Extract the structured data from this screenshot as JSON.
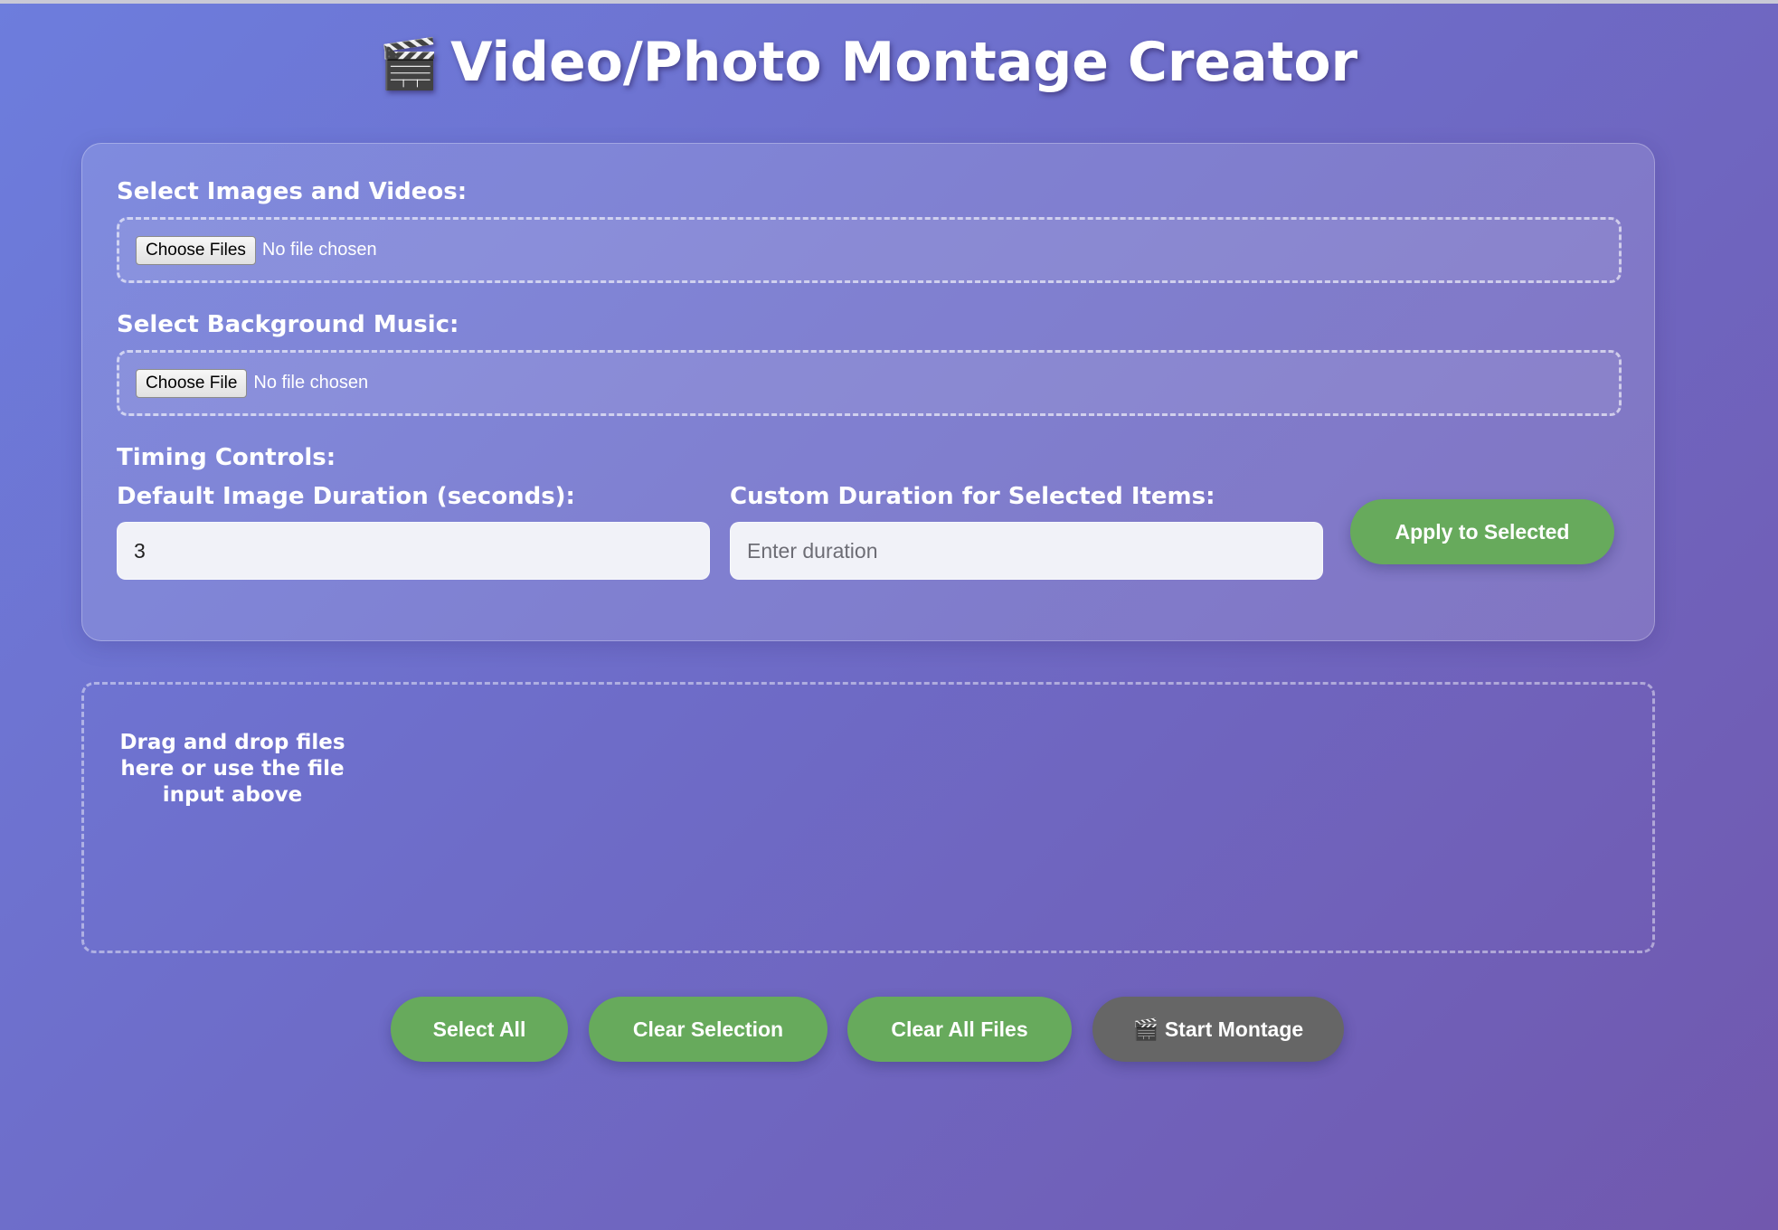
{
  "title": {
    "icon": "🎬",
    "text": "Video/Photo Montage Creator"
  },
  "media_input": {
    "label": "Select Images and Videos:",
    "button_label": "Choose Files",
    "status": "No file chosen"
  },
  "music_input": {
    "label": "Select Background Music:",
    "button_label": "Choose File",
    "status": "No file chosen"
  },
  "timing": {
    "heading": "Timing Controls:",
    "default_label": "Default Image Duration (seconds):",
    "default_value": "3",
    "custom_label": "Custom Duration for Selected Items:",
    "custom_placeholder": "Enter duration",
    "apply_label": "Apply to Selected"
  },
  "drop_zone": {
    "text": "Drag and drop files here or use the file input above"
  },
  "actions": {
    "select_all": "Select All",
    "clear_selection": "Clear Selection",
    "clear_all": "Clear All Files",
    "start_icon": "🎬",
    "start": "Start Montage"
  },
  "colors": {
    "green_button": "#67aa5c",
    "disabled_button": "#666666",
    "background_start": "#6d7ddd",
    "background_end": "#7158ae"
  }
}
